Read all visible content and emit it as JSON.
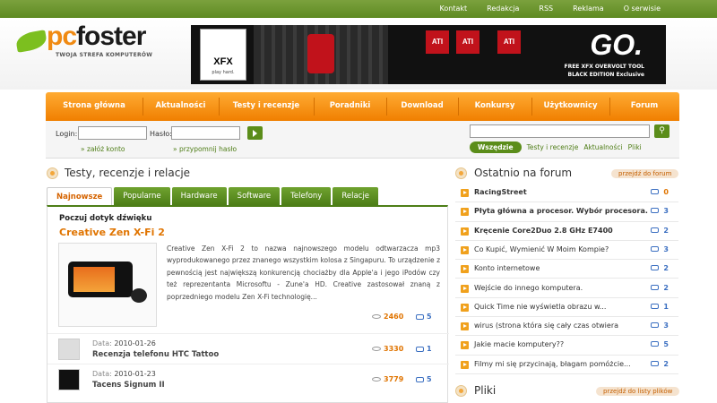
{
  "topbar": {
    "links": [
      "Kontakt",
      "Redakcja",
      "RSS",
      "Reklama",
      "O serwisie"
    ]
  },
  "logo": {
    "word1": "pc",
    "word2": "foster",
    "tagline": "TWOJA STREFA KOMPUTERÓW"
  },
  "banner": {
    "xfx": "XFX",
    "xfx_tag": "play hard.",
    "ati": [
      "ATI",
      "ATI",
      "ATI"
    ],
    "go": "GO.",
    "free_line1": "FREE XFX OVERVOLT TOOL",
    "free_line2": "BLACK EDITION Exclusive"
  },
  "nav": {
    "items": [
      "Strona główna",
      "Aktualności",
      "Testy i recenzje",
      "Poradniki",
      "Download",
      "Konkursy",
      "Użytkownicy",
      "Forum"
    ]
  },
  "login": {
    "login_label": "Login:",
    "pass_label": "Hasło:",
    "register": "» załóż konto",
    "remind": "» przypomnij hasło"
  },
  "search": {
    "tabs": [
      "Wszędzie",
      "Testy i recenzje",
      "Aktualności",
      "Pliki"
    ]
  },
  "main": {
    "title": "Testy, recenzje i relacje",
    "tabs": [
      "Najnowsze",
      "Popularne",
      "Hardware",
      "Software",
      "Telefony",
      "Relacje"
    ],
    "feature": {
      "kicker": "Poczuj dotyk dźwięku",
      "title": "Creative Zen X-Fi 2",
      "desc": "Creative Zen X-Fi 2 to nazwa najnowszego modelu odtwarzacza mp3 wyprodukowanego przez znanego wszystkim kolosa z Singapuru. To urządzenie z pewnością jest największą konkurencją chociażby dla Apple'a i jego iPodów czy też reprezentanta Microsoftu - Zune'a HD. Creative zastosował znaną z poprzedniego modelu Zen X-Fi technologię...",
      "views": "2460",
      "comments": "5"
    },
    "rows": [
      {
        "date_label": "Data:",
        "date": "2010-01-26",
        "title": "Recenzja telefonu HTC Tattoo",
        "views": "3330",
        "comments": "1"
      },
      {
        "date_label": "Data:",
        "date": "2010-01-23",
        "title": "Tacens Signum II",
        "views": "3779",
        "comments": "5"
      }
    ]
  },
  "forum": {
    "title": "Ostatnio na forum",
    "more": "przejdź do forum",
    "items": [
      {
        "t": "RacingStreet",
        "c": "0",
        "bold": true
      },
      {
        "t": "Płyta główna a procesor. Wybór procesora.",
        "c": "3",
        "bold": true
      },
      {
        "t": "Kręcenie Core2Duo 2.8 GHz E7400",
        "c": "2",
        "bold": true
      },
      {
        "t": "Co Kupić, Wymienić W Moim Kompie?",
        "c": "3"
      },
      {
        "t": "Konto internetowe",
        "c": "2"
      },
      {
        "t": "Wejście do innego komputera.",
        "c": "2"
      },
      {
        "t": "Quick Time nie wyświetla obrazu w...",
        "c": "1"
      },
      {
        "t": "wirus (strona która się cały czas otwiera",
        "c": "3"
      },
      {
        "t": "Jakie macie komputery??",
        "c": "5"
      },
      {
        "t": "Filmy mi się przycinają, błagam pomóżcie...",
        "c": "2"
      }
    ]
  },
  "files": {
    "title": "Pliki",
    "more": "przejdź do listy plików"
  }
}
